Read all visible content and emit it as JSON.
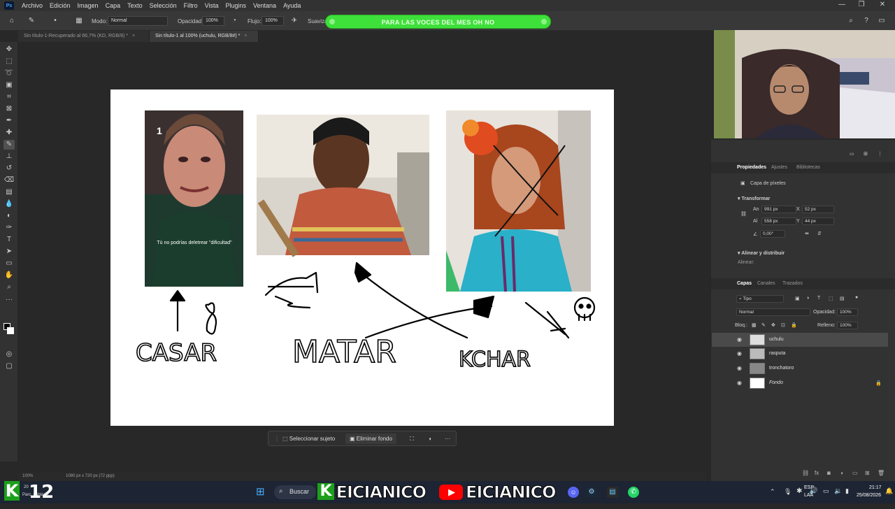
{
  "app": {
    "menu": [
      "Archivo",
      "Edición",
      "Imagen",
      "Capa",
      "Texto",
      "Selección",
      "Filtro",
      "Vista",
      "Plugins",
      "Ventana",
      "Ayuda"
    ],
    "window_controls": [
      "—",
      "❐",
      "✕"
    ]
  },
  "options_bar": {
    "mode_label": "Modo:",
    "mode_value": "Normal",
    "opacity_label": "Opacidad:",
    "opacity_value": "100%",
    "flow_label": "Flujo:",
    "flow_value": "100%",
    "smoothing_label": "Suavizar"
  },
  "banner": {
    "text": "PARA LAS VOCES DEL MES OH NO"
  },
  "tabs": [
    {
      "label": "Sin título-1-Recuperado al 66,7% (KD, RGB/8) *",
      "close": "×"
    },
    {
      "label": "Sin título-1 al 100% (uchulu, RGB/8#) *",
      "close": "×"
    }
  ],
  "canvas": {
    "card1_text": "Tú no podrías deletrear \"dificultad\"",
    "card1_number": "1",
    "drawing": {
      "label_casar": "CASAR",
      "label_matar": "MATAR",
      "label_kchar": "KCHAR"
    }
  },
  "context_bar": {
    "select_subject": "Seleccionar sujeto",
    "remove_background": "Eliminar fondo",
    "more": "···"
  },
  "status_bar": {
    "zoom": "100%",
    "doc_info": "1080 px x 720 px (72 ppp)"
  },
  "properties_panel": {
    "tabs": [
      "Propiedades",
      "Ajustes",
      "Bibliotecas"
    ],
    "pixel_layer_label": "Capa de píxeles",
    "transform_header": "Transformar",
    "w_label": "An",
    "w_value": "991 px",
    "x_label": "X",
    "x_value": "52 px",
    "h_label": "Al",
    "h_value": "558 px",
    "y_label": "Y",
    "y_value": "44 px",
    "angle_value": "0,00°",
    "align_header": "Alinear y distribuir",
    "align_label": "Alinear:"
  },
  "layers_panel": {
    "tabs": [
      "Capas",
      "Canales",
      "Trazados"
    ],
    "filter_value": "Tipo",
    "blend_value": "Normal",
    "opacity_label": "Opacidad:",
    "opacity_value": "100%",
    "lock_label": "Bloq.:",
    "fill_label": "Relleno:",
    "fill_value": "100%",
    "layers": [
      {
        "name": "uchulu",
        "selected": true
      },
      {
        "name": "rasputa",
        "selected": false
      },
      {
        "name": "tronchatoro",
        "selected": false
      },
      {
        "name": "Fondo",
        "selected": false
      }
    ]
  },
  "taskbar": {
    "search_label": "Buscar",
    "brand1": "KEICIANICO",
    "brand2": "EICIANICO",
    "k12": "12",
    "lang_top": "ESP",
    "lang_bottom": "LAA",
    "time": "21:17",
    "date": "25/08/2026",
    "left_small_top": "20",
    "left_small_bottom": "Parc. nublado"
  },
  "colors": {
    "accent_green": "#3ee03a",
    "ps_bg": "#282828",
    "panel_bg": "#323232",
    "taskbar_bg": "#1d2433"
  }
}
